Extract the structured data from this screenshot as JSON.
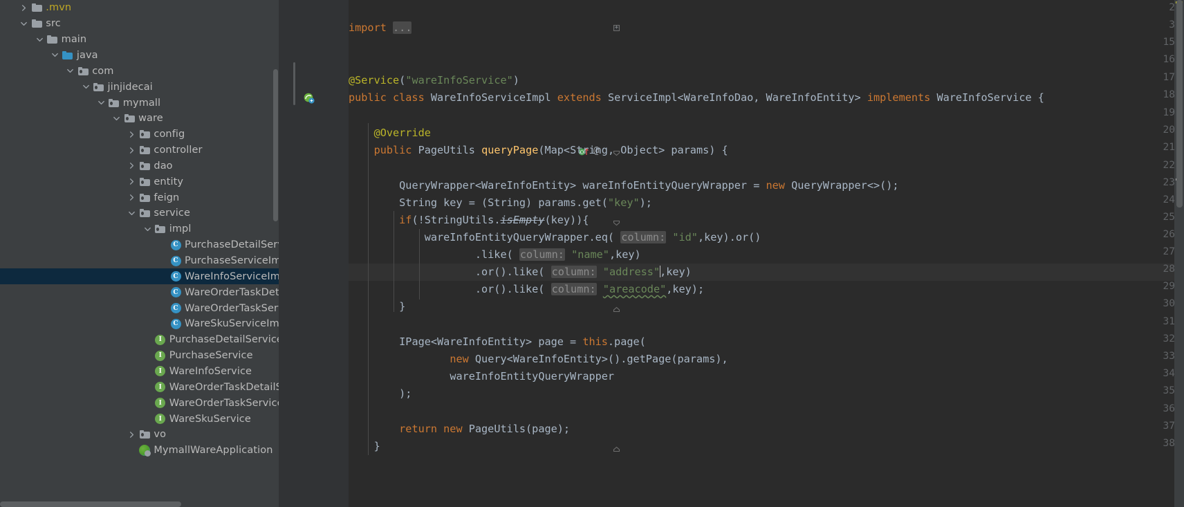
{
  "window": {
    "theme": "darcula",
    "background": "#3c3f41",
    "editor_background": "#2b2b2b",
    "gutter_background": "#313335",
    "selection_color": "#0d293e",
    "caret_line_color": "#323232"
  },
  "project_tree": {
    "name": "project-tree",
    "items": [
      {
        "label": ".mvn",
        "depth": 1,
        "type": "folder",
        "arrow": "collapsed",
        "color": "#bfa824"
      },
      {
        "label": "src",
        "depth": 1,
        "type": "folder",
        "arrow": "expanded",
        "color": "#bbbbbb"
      },
      {
        "label": "main",
        "depth": 2,
        "type": "folder",
        "arrow": "expanded",
        "color": "#bbbbbb"
      },
      {
        "label": "java",
        "depth": 3,
        "type": "source-folder",
        "arrow": "expanded",
        "color": "#bbbbbb"
      },
      {
        "label": "com",
        "depth": 4,
        "type": "package",
        "arrow": "expanded",
        "color": "#bbbbbb"
      },
      {
        "label": "jinjidecai",
        "depth": 5,
        "type": "package",
        "arrow": "expanded",
        "color": "#bbbbbb"
      },
      {
        "label": "mymall",
        "depth": 6,
        "type": "package",
        "arrow": "expanded",
        "color": "#bbbbbb"
      },
      {
        "label": "ware",
        "depth": 7,
        "type": "package",
        "arrow": "expanded",
        "color": "#bbbbbb"
      },
      {
        "label": "config",
        "depth": 8,
        "type": "package",
        "arrow": "collapsed",
        "color": "#bbbbbb"
      },
      {
        "label": "controller",
        "depth": 8,
        "type": "package",
        "arrow": "collapsed",
        "color": "#bbbbbb"
      },
      {
        "label": "dao",
        "depth": 8,
        "type": "package",
        "arrow": "collapsed",
        "color": "#bbbbbb"
      },
      {
        "label": "entity",
        "depth": 8,
        "type": "package",
        "arrow": "collapsed",
        "color": "#bbbbbb"
      },
      {
        "label": "feign",
        "depth": 8,
        "type": "package",
        "arrow": "collapsed",
        "color": "#bbbbbb"
      },
      {
        "label": "service",
        "depth": 8,
        "type": "package",
        "arrow": "expanded",
        "color": "#bbbbbb"
      },
      {
        "label": "impl",
        "depth": 9,
        "type": "package",
        "arrow": "expanded",
        "color": "#bbbbbb"
      },
      {
        "label": "PurchaseDetailServiceImpl",
        "depth": 10,
        "type": "class",
        "arrow": "none",
        "color": "#bbbbbb"
      },
      {
        "label": "PurchaseServiceImpl",
        "depth": 10,
        "type": "class",
        "arrow": "none",
        "color": "#bbbbbb"
      },
      {
        "label": "WareInfoServiceImpl",
        "depth": 10,
        "type": "class",
        "arrow": "none",
        "color": "#bbbbbb",
        "selected": true
      },
      {
        "label": "WareOrderTaskDetailServiceImpl",
        "depth": 10,
        "type": "class",
        "arrow": "none",
        "color": "#bbbbbb"
      },
      {
        "label": "WareOrderTaskServiceImpl",
        "depth": 10,
        "type": "class",
        "arrow": "none",
        "color": "#bbbbbb"
      },
      {
        "label": "WareSkuServiceImpl",
        "depth": 10,
        "type": "class",
        "arrow": "none",
        "color": "#bbbbbb"
      },
      {
        "label": "PurchaseDetailService",
        "depth": 9,
        "type": "interface",
        "arrow": "none",
        "color": "#bbbbbb"
      },
      {
        "label": "PurchaseService",
        "depth": 9,
        "type": "interface",
        "arrow": "none",
        "color": "#bbbbbb"
      },
      {
        "label": "WareInfoService",
        "depth": 9,
        "type": "interface",
        "arrow": "none",
        "color": "#bbbbbb"
      },
      {
        "label": "WareOrderTaskDetailService",
        "depth": 9,
        "type": "interface",
        "arrow": "none",
        "color": "#bbbbbb"
      },
      {
        "label": "WareOrderTaskService",
        "depth": 9,
        "type": "interface",
        "arrow": "none",
        "color": "#bbbbbb"
      },
      {
        "label": "WareSkuService",
        "depth": 9,
        "type": "interface",
        "arrow": "none",
        "color": "#bbbbbb"
      },
      {
        "label": "vo",
        "depth": 8,
        "type": "package",
        "arrow": "collapsed",
        "color": "#bbbbbb"
      },
      {
        "label": "MymallWareApplication",
        "depth": 8,
        "type": "spring-app",
        "arrow": "none",
        "color": "#bbbbbb"
      }
    ]
  },
  "editor": {
    "name": "code-editor",
    "language": "java",
    "file": "WareInfoServiceImpl",
    "caret_line": 28,
    "line_numbers": [
      2,
      3,
      15,
      16,
      17,
      18,
      19,
      20,
      21,
      22,
      23,
      24,
      25,
      26,
      27,
      28,
      29,
      30,
      31,
      32,
      33,
      34,
      35,
      36,
      37,
      38
    ],
    "gutter_icons": [
      {
        "line": 18,
        "icon": "spring-bean-icon"
      },
      {
        "line": 21,
        "icon": "overriding-method-icon"
      },
      {
        "line": 21,
        "icon": "annotation-icon",
        "glyph": "@"
      }
    ],
    "lines": [
      {
        "no": 2,
        "text": ""
      },
      {
        "no": 3,
        "text": "import ..."
      },
      {
        "no": 15,
        "text": ""
      },
      {
        "no": 16,
        "text": ""
      },
      {
        "no": 17,
        "text": "@Service(\"wareInfoService\")"
      },
      {
        "no": 18,
        "text": "public class WareInfoServiceImpl extends ServiceImpl<WareInfoDao, WareInfoEntity> implements WareInfoService {"
      },
      {
        "no": 19,
        "text": ""
      },
      {
        "no": 20,
        "text": "    @Override"
      },
      {
        "no": 21,
        "text": "    public PageUtils queryPage(Map<String, Object> params) {"
      },
      {
        "no": 22,
        "text": ""
      },
      {
        "no": 23,
        "text": "        QueryWrapper<WareInfoEntity> wareInfoEntityQueryWrapper = new QueryWrapper<>();"
      },
      {
        "no": 24,
        "text": "        String key = (String) params.get(\"key\");"
      },
      {
        "no": 25,
        "text": "        if(!StringUtils.isEmpty(key)){"
      },
      {
        "no": 26,
        "text": "            wareInfoEntityQueryWrapper.eq( column: \"id\",key).or()"
      },
      {
        "no": 27,
        "text": "                    .like( column: \"name\",key)"
      },
      {
        "no": 28,
        "text": "                    .or().like( column: \"address\",key)"
      },
      {
        "no": 29,
        "text": "                    .or().like( column: \"areacode\",key);"
      },
      {
        "no": 30,
        "text": "        }"
      },
      {
        "no": 31,
        "text": ""
      },
      {
        "no": 32,
        "text": "        IPage<WareInfoEntity> page = this.page("
      },
      {
        "no": 33,
        "text": "                new Query<WareInfoEntity>().getPage(params),"
      },
      {
        "no": 34,
        "text": "                wareInfoEntityQueryWrapper"
      },
      {
        "no": 35,
        "text": "        );"
      },
      {
        "no": 36,
        "text": ""
      },
      {
        "no": 37,
        "text": "        return new PageUtils(page);"
      },
      {
        "no": 38,
        "text": "    }"
      }
    ],
    "parameter_hints": [
      "column:"
    ],
    "syntax_colors": {
      "keyword": "#cc7832",
      "string": "#6a8759",
      "annotation": "#bbb529",
      "method": "#ffc66d",
      "identifier": "#a9b7c6",
      "comment": "#808080",
      "line_number": "#606366",
      "inlay_hint": "#8c8c8c"
    }
  },
  "scrollbars": {
    "vertical_editor": "editor-vertical-scrollbar",
    "vertical_tree": "project-tree-scrollbar",
    "horizontal_tree": "project-tree-horizontal-scrollbar"
  }
}
